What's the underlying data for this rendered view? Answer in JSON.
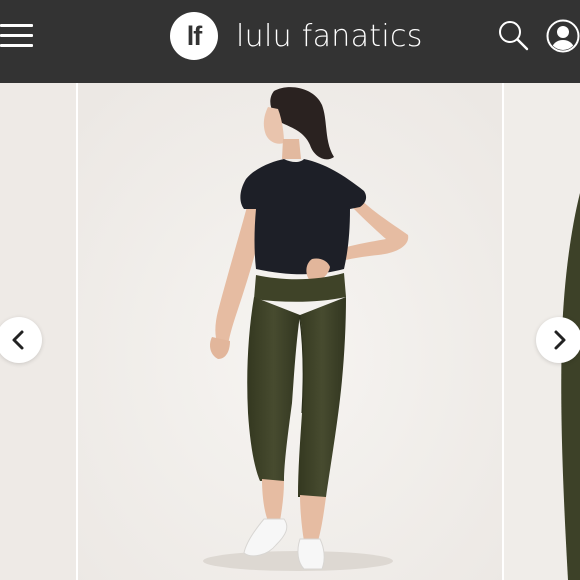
{
  "header": {
    "logo_text": "lf",
    "brand_name": "lulu fanatics"
  },
  "icons": {
    "menu": "hamburger-menu-icon",
    "search": "search-icon",
    "account": "user-account-icon",
    "prev": "chevron-left-icon",
    "next": "chevron-right-icon"
  },
  "colors": {
    "header_bg": "#333333",
    "header_text": "#ffffff",
    "leggings": "#3d4128",
    "tee": "#1d1f27"
  },
  "carousel": {
    "current_image": "model-wearing-olive-cropped-leggings-and-black-tee"
  }
}
